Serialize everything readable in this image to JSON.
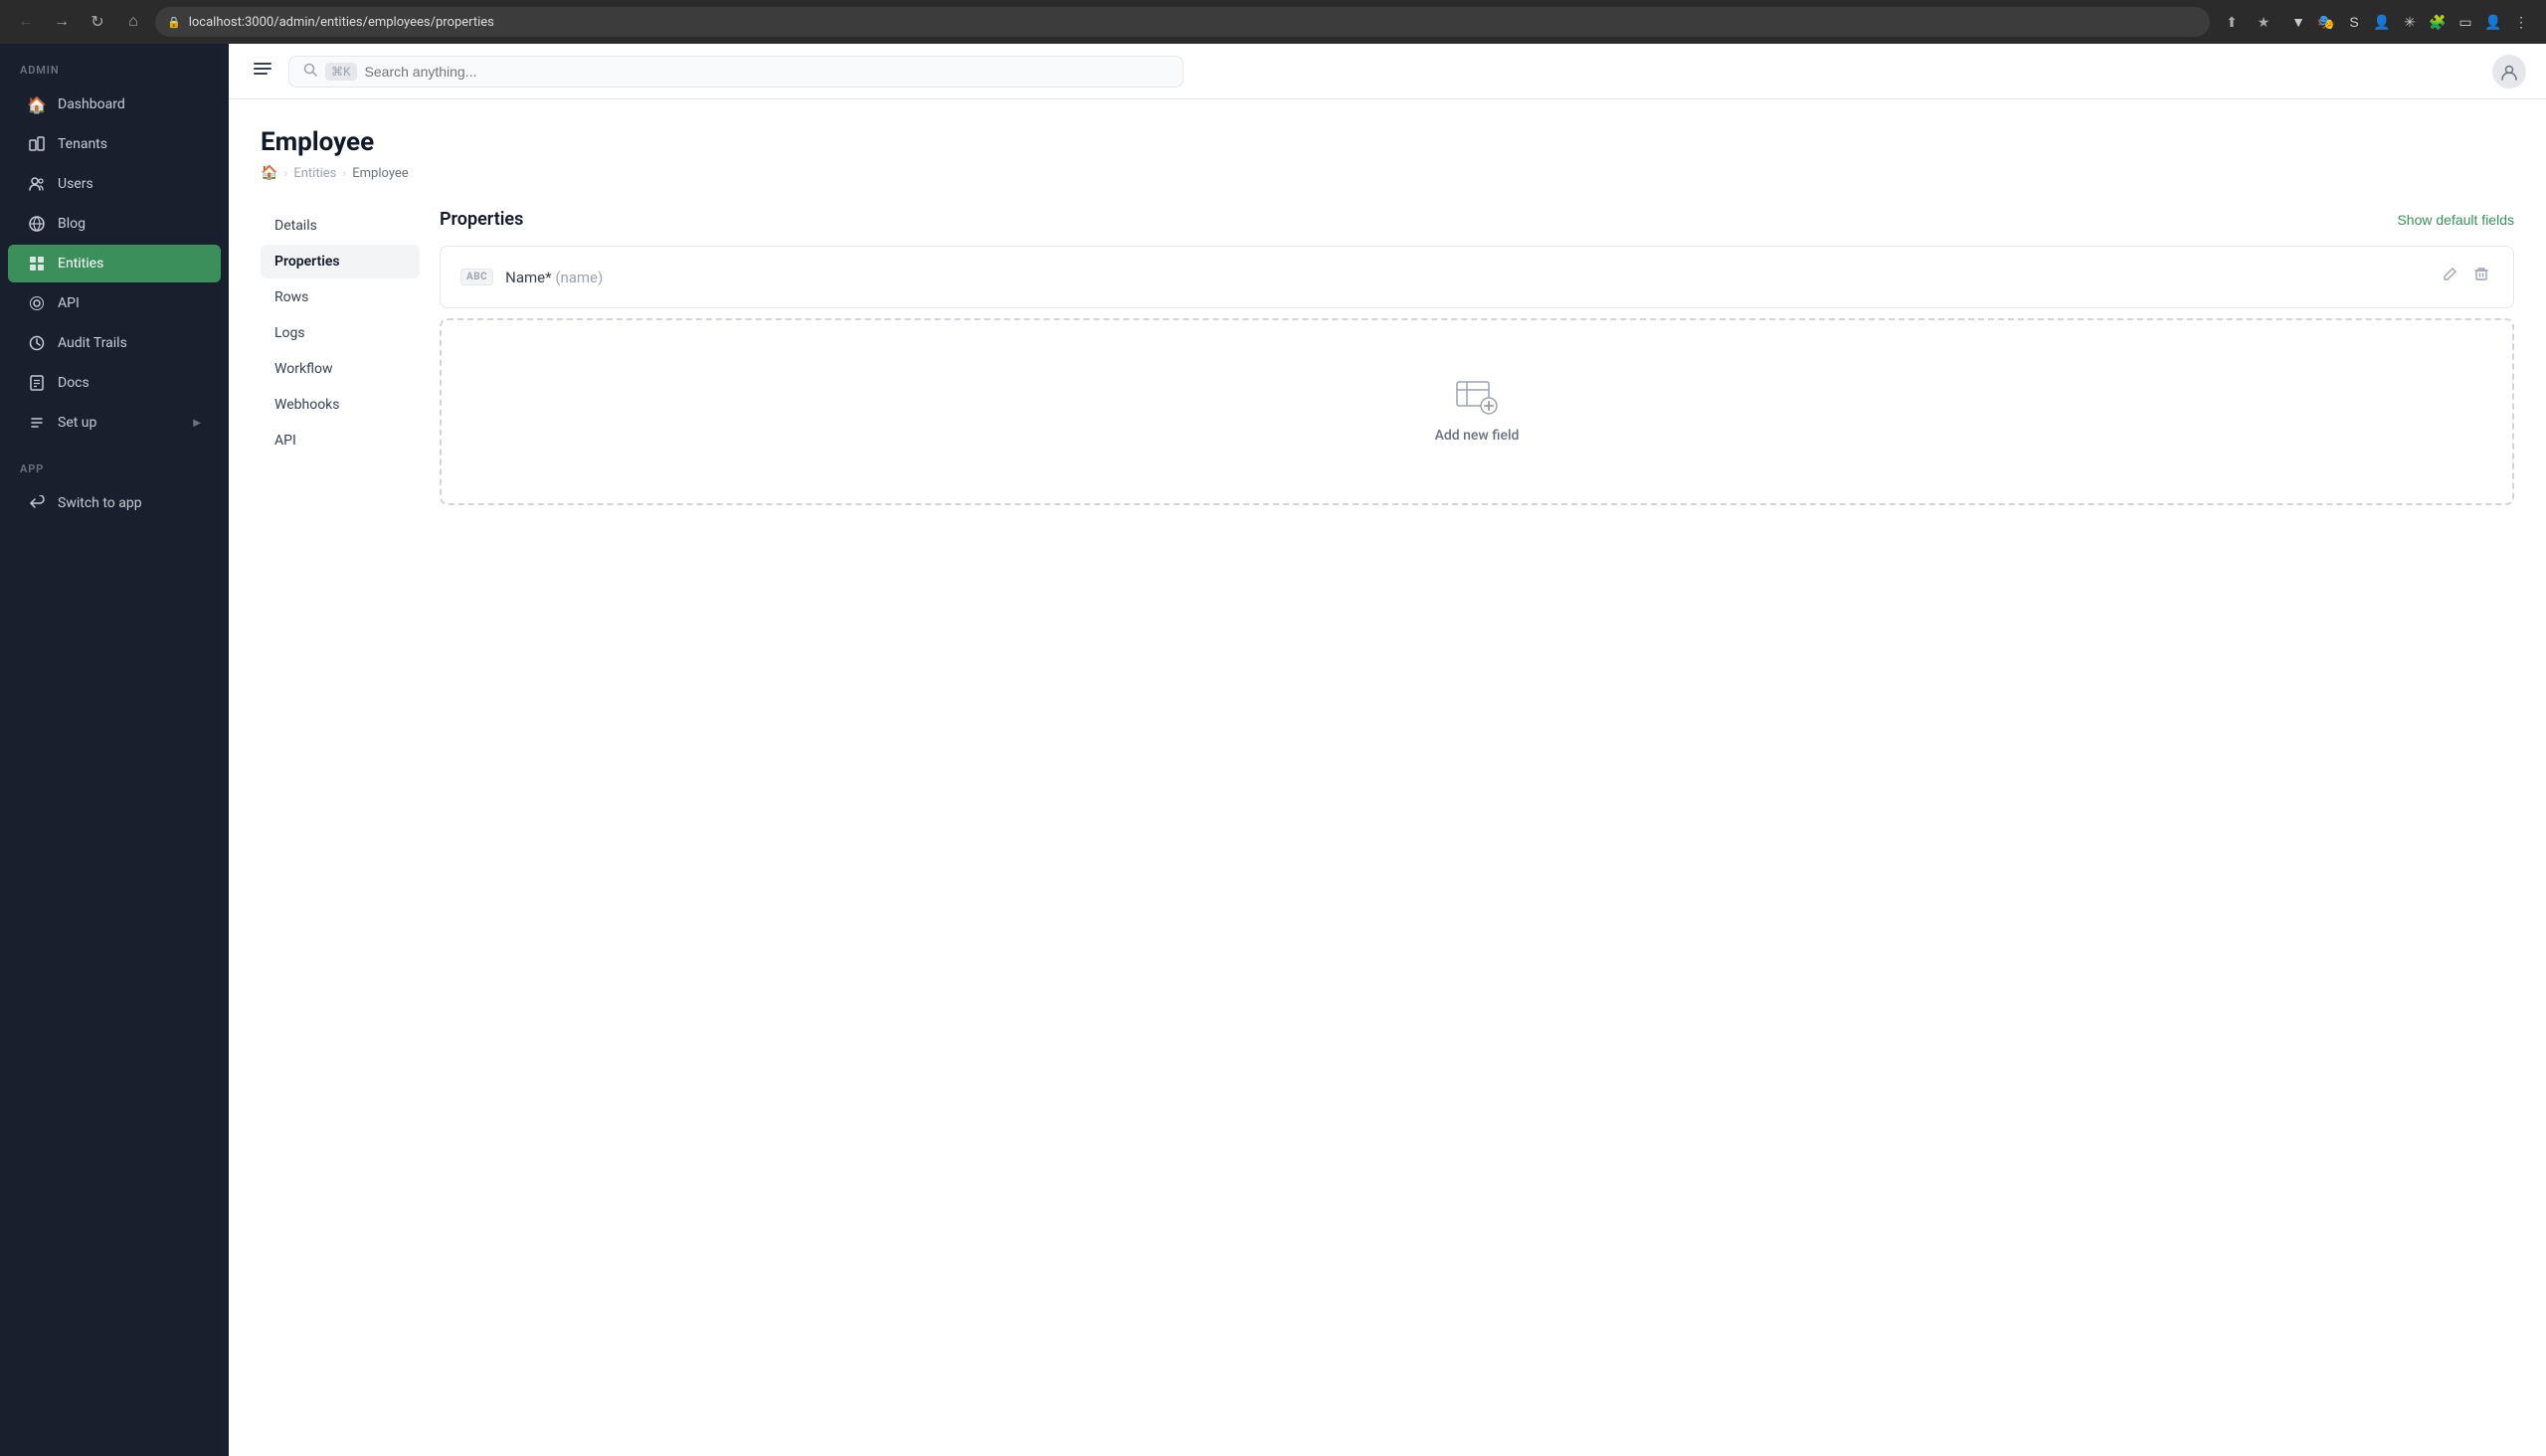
{
  "browser": {
    "url": "localhost:3000/admin/entities/employees/properties",
    "back_btn": "←",
    "forward_btn": "→",
    "reload_btn": "↻",
    "home_btn": "⌂",
    "search_placeholder": "Search anything...",
    "shortcut": "⌘K"
  },
  "sidebar": {
    "admin_label": "ADMIN",
    "app_label": "APP",
    "items": [
      {
        "id": "dashboard",
        "label": "Dashboard",
        "icon": "🏠"
      },
      {
        "id": "tenants",
        "label": "Tenants",
        "icon": "👥"
      },
      {
        "id": "users",
        "label": "Users",
        "icon": "👤"
      },
      {
        "id": "blog",
        "label": "Blog",
        "icon": "📡"
      },
      {
        "id": "entities",
        "label": "Entities",
        "icon": "📦",
        "active": true
      },
      {
        "id": "api",
        "label": "API",
        "icon": "🔑"
      },
      {
        "id": "audit-trails",
        "label": "Audit Trails",
        "icon": "🔄"
      },
      {
        "id": "docs",
        "label": "Docs",
        "icon": "📄"
      },
      {
        "id": "setup",
        "label": "Set up",
        "icon": "</>",
        "arrow": "▶"
      }
    ],
    "app_items": [
      {
        "id": "switch-to-app",
        "label": "Switch to app",
        "icon": "↩"
      }
    ]
  },
  "topbar": {
    "menu_icon": "☰",
    "search_placeholder": "Search anything...",
    "shortcut": "⌘K"
  },
  "page": {
    "title": "Employee",
    "breadcrumb": {
      "home": "🏠",
      "items": [
        "Entities",
        "Employee"
      ]
    }
  },
  "entity_nav": {
    "items": [
      {
        "id": "details",
        "label": "Details"
      },
      {
        "id": "properties",
        "label": "Properties",
        "active": true
      },
      {
        "id": "rows",
        "label": "Rows"
      },
      {
        "id": "logs",
        "label": "Logs"
      },
      {
        "id": "workflow",
        "label": "Workflow"
      },
      {
        "id": "webhooks",
        "label": "Webhooks"
      },
      {
        "id": "api",
        "label": "API"
      }
    ]
  },
  "properties": {
    "title": "Properties",
    "show_default_label": "Show default fields",
    "fields": [
      {
        "type": "ABC",
        "name": "Name*",
        "slug": "(name)"
      }
    ],
    "add_field_label": "Add new field"
  }
}
